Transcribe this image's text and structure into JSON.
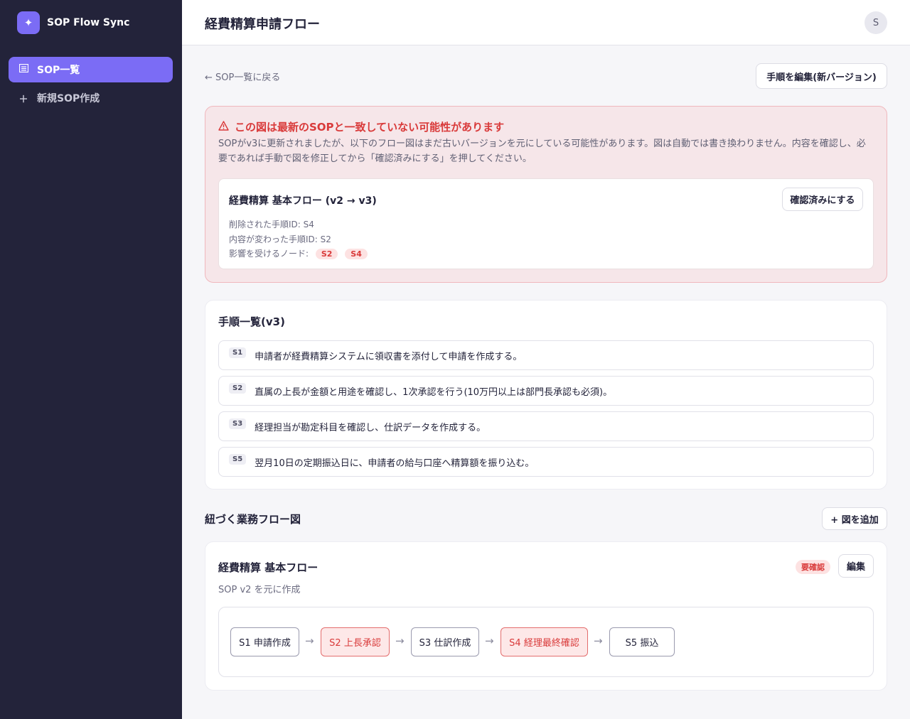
{
  "app": {
    "name": "SOP Flow Sync",
    "logo_glyph": "✦",
    "accent": "#7b6cf5"
  },
  "sidebar": {
    "items": [
      {
        "label": "SOP一覧",
        "icon": "list-icon",
        "active": true
      },
      {
        "label": "新規SOP作成",
        "icon": "plus-icon",
        "active": false
      }
    ]
  },
  "header": {
    "title": "経費精算申請フロー",
    "avatar": "S"
  },
  "toolbar": {
    "back_label": "← SOP一覧に戻る",
    "edit_label": "手順を編集(新バージョン)"
  },
  "alert": {
    "title": "この図は最新のSOPと一致していない可能性があります",
    "body": "SOPがv3に更新されましたが、以下のフロー図はまだ古いバージョンを元にしている可能性があります。図は自動では書き換わりません。内容を確認し、必要であれば手動で図を修正してから「確認済みにする」を押してください。",
    "card_title": "経費精算 基本フロー (v2 → v3)",
    "confirm_label": "確認済みにする",
    "deleted_line": "削除された手順ID: S4",
    "changed_line": "内容が変わった手順ID: S2",
    "affected_label": "影響を受けるノード:",
    "affected_nodes": [
      "S2",
      "S4"
    ]
  },
  "steps": {
    "title": "手順一覧(v3)",
    "items": [
      {
        "id": "S1",
        "text": "申請者が経費精算システムに領収書を添付して申請を作成する。"
      },
      {
        "id": "S2",
        "text": "直属の上長が金額と用途を確認し、1次承認を行う(10万円以上は部門長承認も必須)。"
      },
      {
        "id": "S3",
        "text": "経理担当が勘定科目を確認し、仕訳データを作成する。"
      },
      {
        "id": "S5",
        "text": "翌月10日の定期振込日に、申請者の給与口座へ精算額を振り込む。"
      }
    ]
  },
  "flows": {
    "title": "紐づく業務フロー図",
    "add_label": "+ 図を追加",
    "card": {
      "title": "経費精算 基本フロー",
      "subtitle": "SOP v2 を元に作成",
      "badge": "要確認",
      "edit_label": "編集",
      "nodes": [
        {
          "label": "S1 申請作成",
          "warn": false
        },
        {
          "label": "S2 上長承認",
          "warn": true
        },
        {
          "label": "S3 仕訳作成",
          "warn": false
        },
        {
          "label": "S4 経理最終確認",
          "warn": true
        },
        {
          "label": "S5 振込",
          "warn": false
        }
      ],
      "arrow": "→"
    }
  }
}
